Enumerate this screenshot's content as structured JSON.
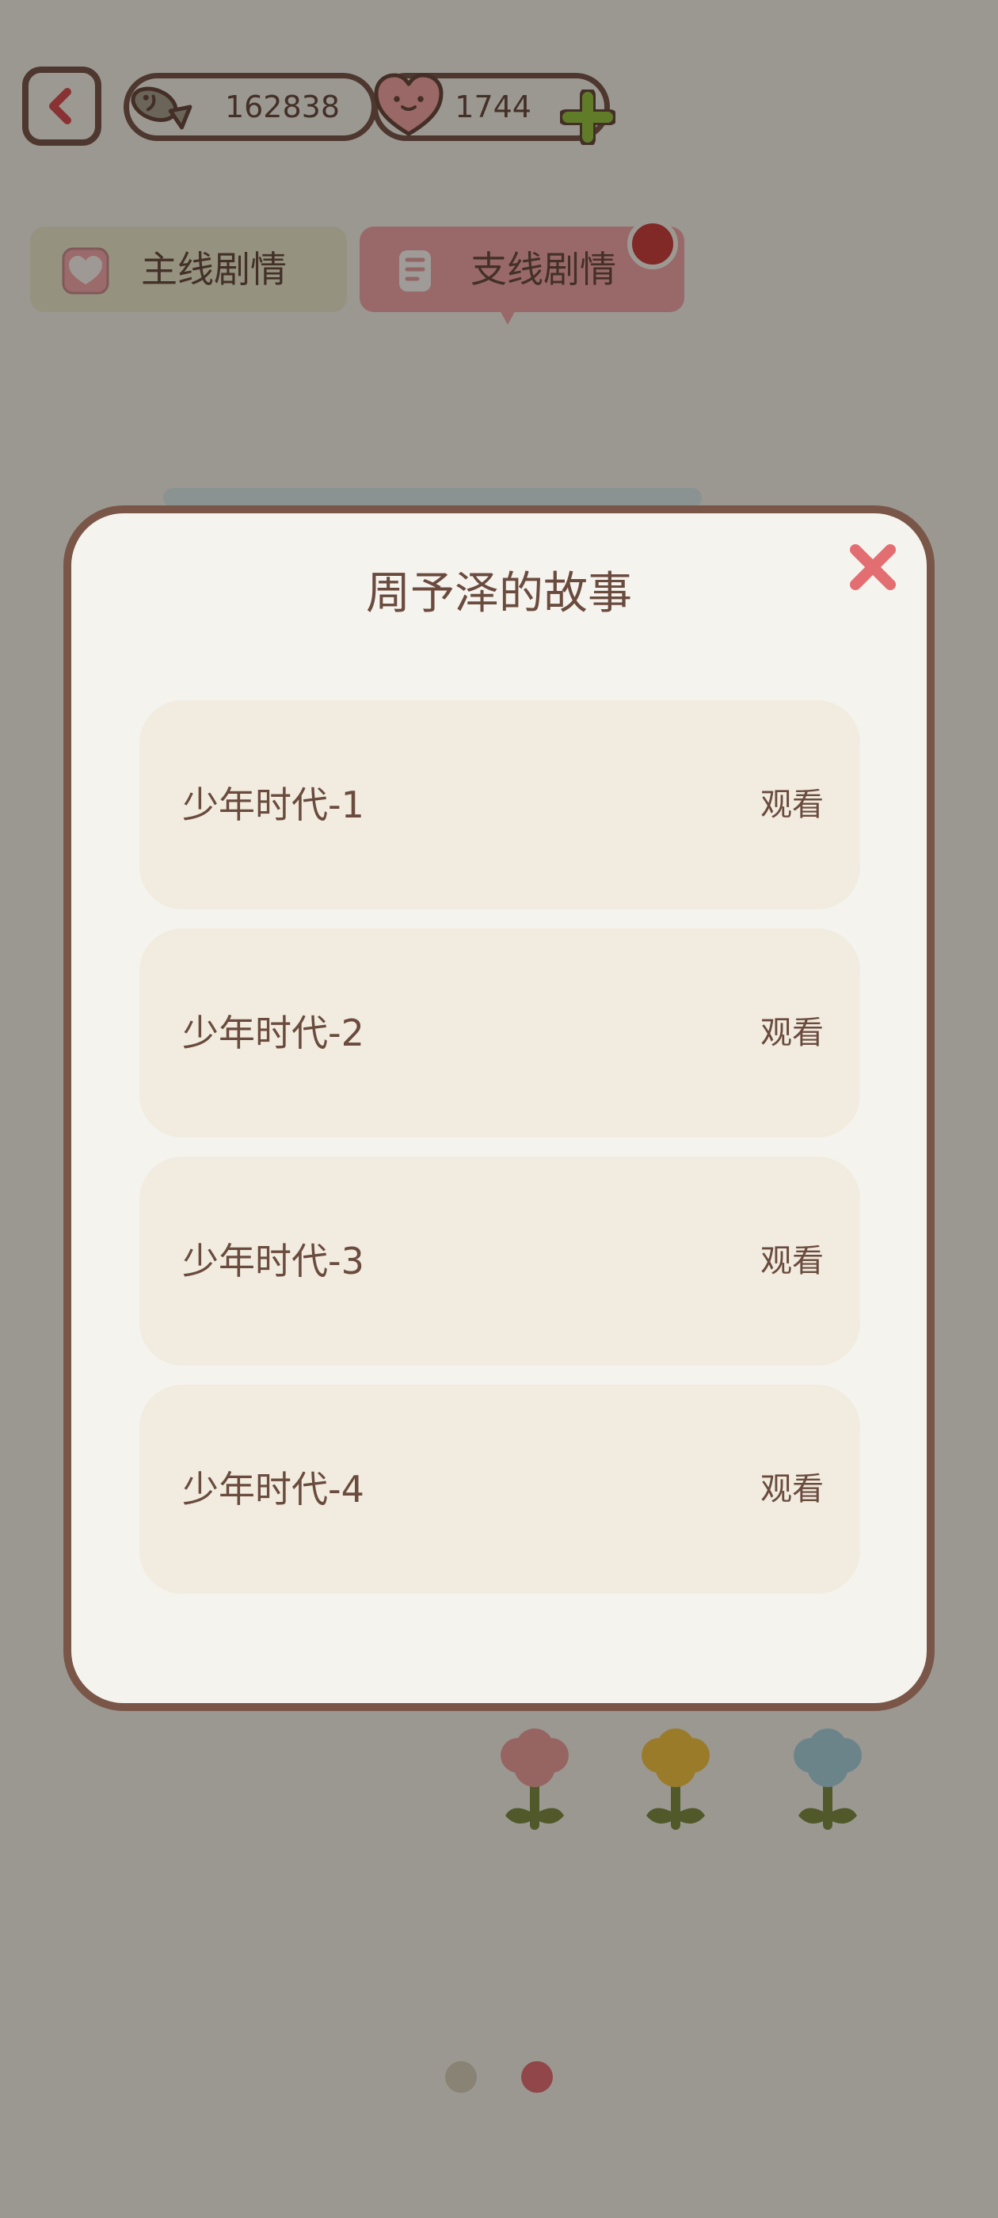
{
  "top_bar": {
    "fish_count": "162838",
    "heart_count": "1744"
  },
  "tabs": {
    "main_label": "主线剧情",
    "side_label": "支线剧情"
  },
  "dialog": {
    "title": "周予泽的故事",
    "items": [
      {
        "title": "少年时代-1",
        "action": "观看"
      },
      {
        "title": "少年时代-2",
        "action": "观看"
      },
      {
        "title": "少年时代-3",
        "action": "观看"
      },
      {
        "title": "少年时代-4",
        "action": "观看"
      }
    ]
  },
  "icons": {
    "back": "back-icon",
    "fish": "fish-icon",
    "heart": "heart-icon",
    "add": "plus-icon",
    "main_tab": "heart-card-icon",
    "side_tab": "note-icon",
    "close": "close-icon",
    "flower": "flower-icon"
  },
  "colors": {
    "overlay": "#000000",
    "dialog_background": "#f5f3ee",
    "dialog_border": "#7a5648",
    "list_item_background": "#f1ecdf",
    "main_tab": "#e9e5c9",
    "side_tab": "#f0a4a4",
    "accent_red": "#e36e72",
    "accent_green": "#8ab143"
  }
}
